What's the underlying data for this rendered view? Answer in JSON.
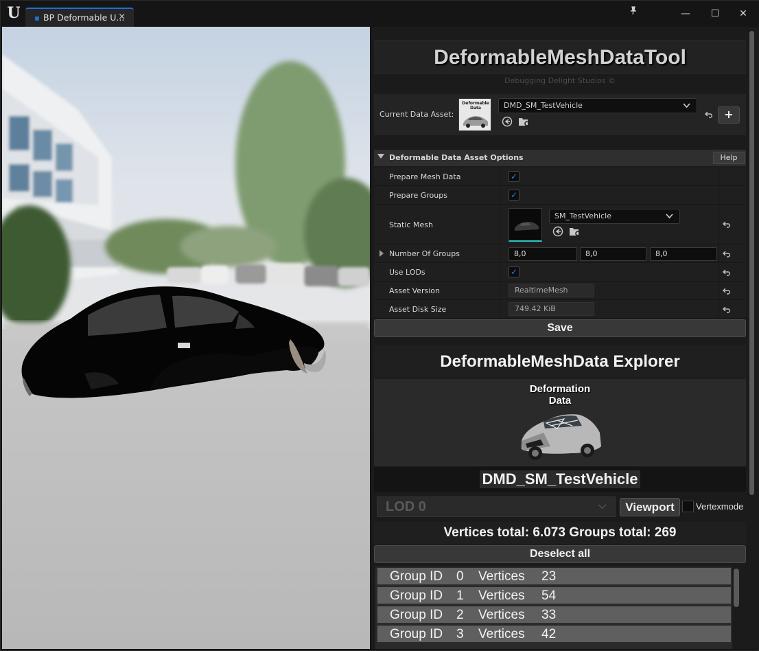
{
  "window": {
    "tab_title": "BP Deformable U...",
    "tab_close": "×",
    "logo": "U",
    "controls": {
      "minimize": "—",
      "maximize": "☐",
      "close": "✕"
    }
  },
  "tool": {
    "title": "DeformableMeshDataTool",
    "subtitle": "Debugging Delight Studios ©",
    "current_asset_label": "Current Data Asset:",
    "current_asset_value": "DMD_SM_TestVehicle",
    "asset_thumb_text": "Deformable Data",
    "add_button": "+"
  },
  "options": {
    "section_title": "Deformable Data Asset Options",
    "help_label": "Help",
    "prepare_mesh_data": {
      "label": "Prepare Mesh Data",
      "checked": true
    },
    "prepare_groups": {
      "label": "Prepare Groups",
      "checked": true
    },
    "static_mesh": {
      "label": "Static Mesh",
      "value": "SM_TestVehicle"
    },
    "number_of_groups": {
      "label": "Number Of Groups",
      "x": "8,0",
      "y": "8,0",
      "z": "8,0"
    },
    "use_lods": {
      "label": "Use LODs",
      "checked": true
    },
    "asset_version": {
      "label": "Asset Version",
      "value": "RealtimeMesh"
    },
    "asset_disk_size": {
      "label": "Asset Disk Size",
      "value": "749.42 KiB"
    }
  },
  "save_label": "Save",
  "explorer": {
    "title": "DeformableMeshData Explorer",
    "image_title_line1": "Deformation",
    "image_title_line2": "Data",
    "asset_name": "DMD_SM_TestVehicle",
    "lod_value": "LOD 0",
    "viewport_label": "Viewport",
    "vertexmode_label": "Vertexmode",
    "vertexmode_checked": false,
    "totals": "Vertices total: 6.073 Groups total: 269",
    "deselect_label": "Deselect all",
    "groups": [
      {
        "label": "Group ID",
        "id": "0",
        "vlabel": "Vertices",
        "count": "23"
      },
      {
        "label": "Group ID",
        "id": "1",
        "vlabel": "Vertices",
        "count": "54"
      },
      {
        "label": "Group ID",
        "id": "2",
        "vlabel": "Vertices",
        "count": "33"
      },
      {
        "label": "Group ID",
        "id": "3",
        "vlabel": "Vertices",
        "count": "42"
      }
    ]
  },
  "icons": {
    "browse": "arrow-left-circle-icon",
    "find": "folder-search-icon",
    "reset": "reset-arrow-icon",
    "dropdown": "chevron-down-icon",
    "check": "checkmark-icon",
    "expand": "triangle-right-icon"
  },
  "colors": {
    "accent": "#2f7dd6",
    "panel_bg": "#1b1b1b",
    "row_bg": "#5f5f5f"
  }
}
